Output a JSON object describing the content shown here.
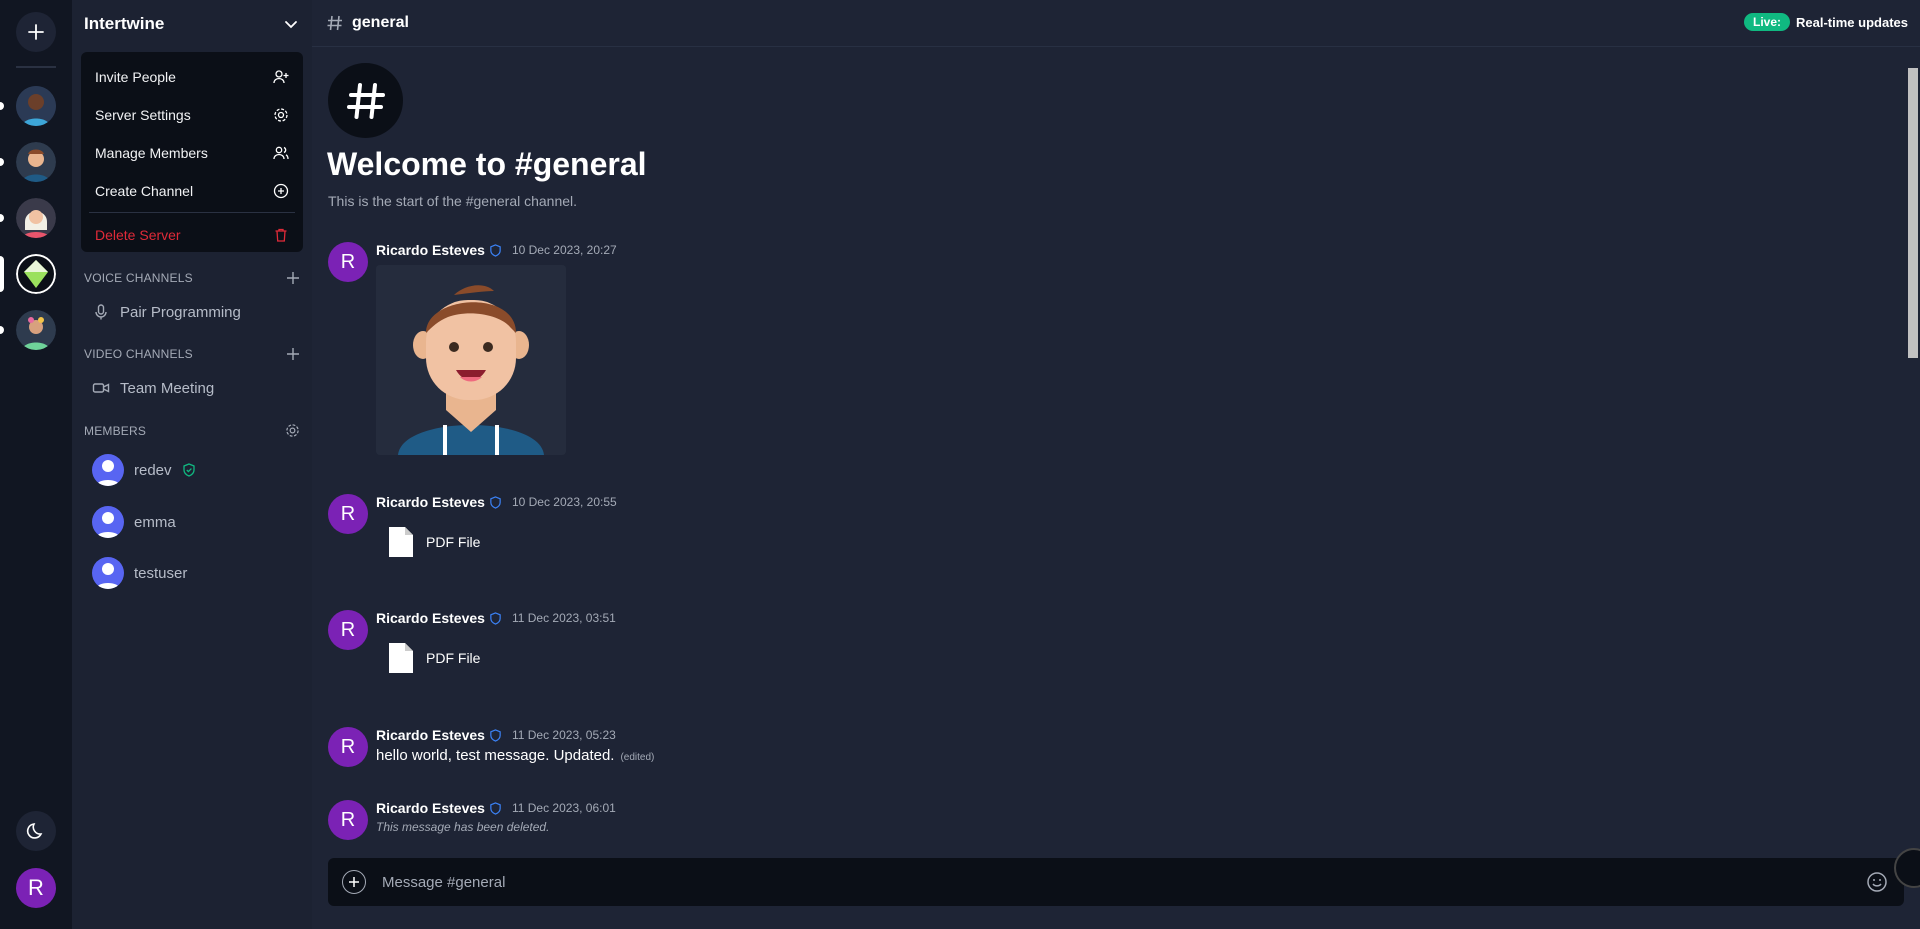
{
  "rail": {
    "add_server_icon": "plus-icon",
    "theme_toggle_icon": "moon-icon",
    "user_initial": "R",
    "servers": [
      {
        "name": "server-1",
        "bg": "#2b3a55"
      },
      {
        "name": "server-2",
        "bg": "#2e3b4e"
      },
      {
        "name": "server-3",
        "bg": "#3a3a4a"
      },
      {
        "name": "server-4",
        "bg": "#0b0f17"
      },
      {
        "name": "server-5",
        "bg": "#2e3b4e"
      }
    ]
  },
  "server": {
    "name": "Intertwine",
    "menu": {
      "invite": "Invite People",
      "settings": "Server Settings",
      "manage": "Manage Members",
      "create": "Create Channel",
      "delete": "Delete Server"
    },
    "sections": {
      "voice": "VOICE CHANNELS",
      "video": "VIDEO CHANNELS",
      "members": "MEMBERS"
    },
    "voice_channels": [
      "Pair Programming"
    ],
    "video_channels": [
      "Team Meeting"
    ],
    "members": [
      "redev",
      "emma",
      "testuser"
    ]
  },
  "channel": {
    "name": "general",
    "live_label": "Live:",
    "live_text": "Real-time updates",
    "welcome_title": "Welcome to #general",
    "welcome_sub": "This is the start of the #general channel."
  },
  "messages": [
    {
      "author": "Ricardo Esteves",
      "initial": "R",
      "time": "10 Dec 2023, 20:27"
    },
    {
      "author": "Ricardo Esteves",
      "initial": "R",
      "time": "10 Dec 2023, 20:55",
      "file": "PDF File"
    },
    {
      "author": "Ricardo Esteves",
      "initial": "R",
      "time": "11 Dec 2023, 03:51",
      "file": "PDF File"
    },
    {
      "author": "Ricardo Esteves",
      "initial": "R",
      "time": "11 Dec 2023, 05:23",
      "text": "hello world, test message. Updated.",
      "edited": "(edited)"
    },
    {
      "author": "Ricardo Esteves",
      "initial": "R",
      "time": "11 Dec 2023, 06:01",
      "deleted": "This message has been deleted."
    }
  ],
  "composer": {
    "placeholder": "Message #general"
  },
  "colors": {
    "accent": "#7b22b5",
    "danger": "#e02a38",
    "live": "#10b981",
    "member_avatar": "#5865f2"
  }
}
